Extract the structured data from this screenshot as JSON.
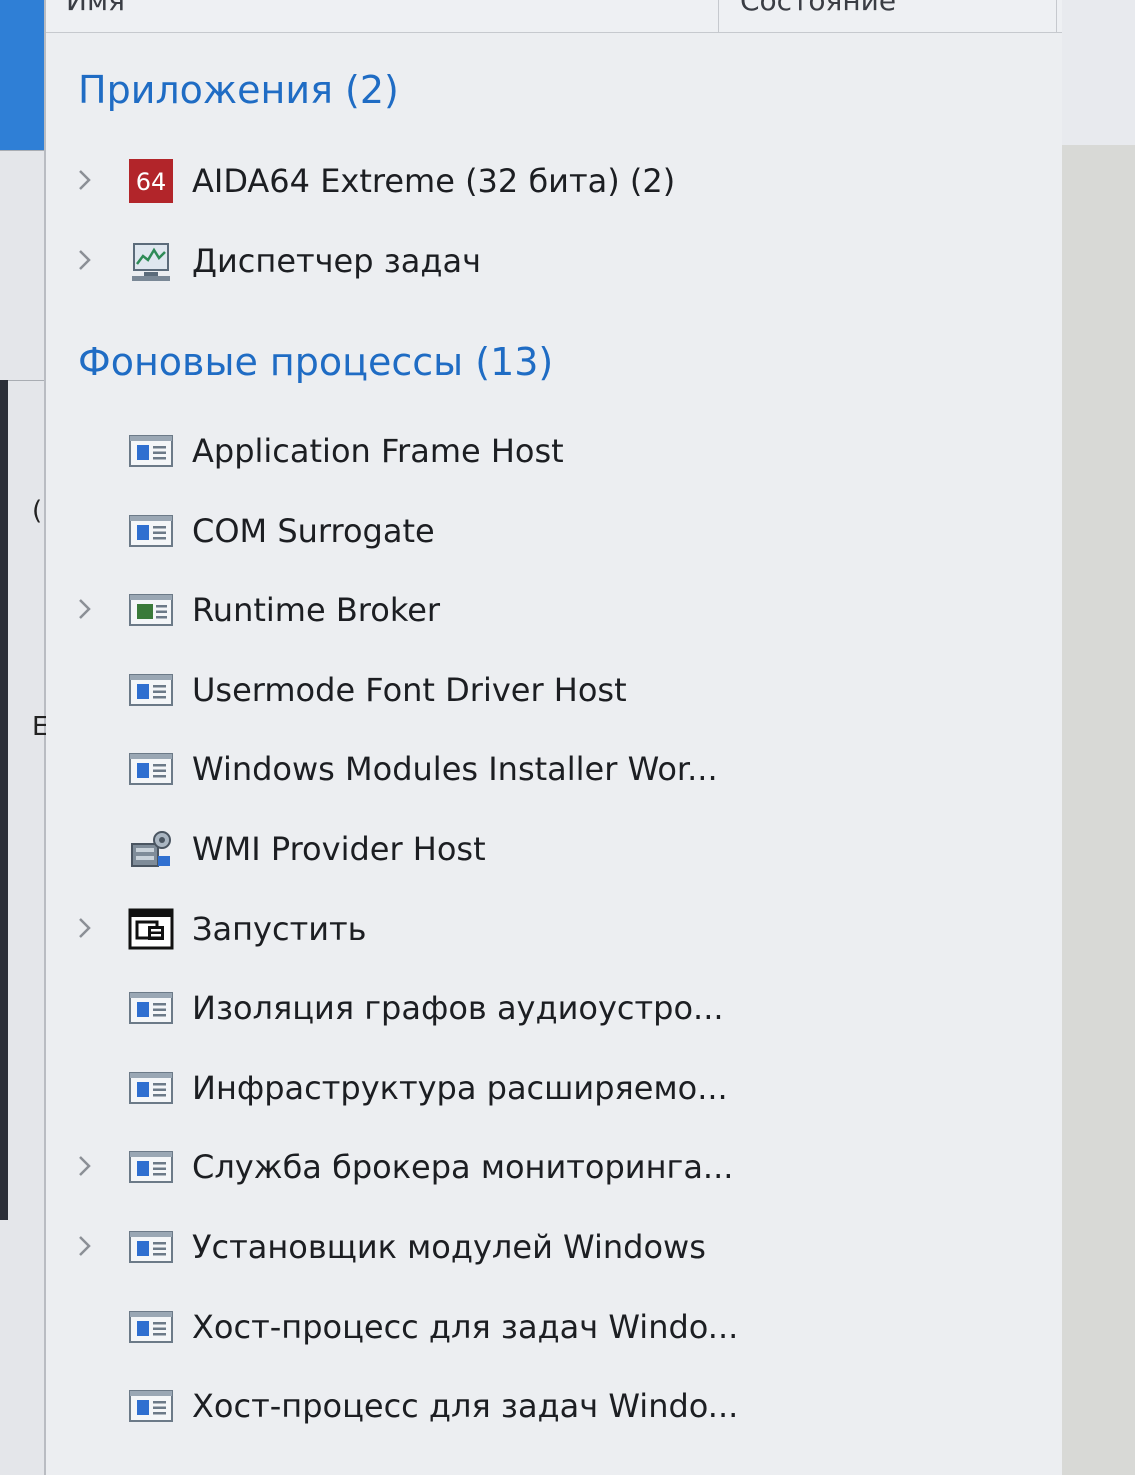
{
  "header": {
    "col_name": "Имя",
    "col_status": "Состояние"
  },
  "sidebar_fragments": {
    "frag1": "(",
    "frag2": "E"
  },
  "groups": {
    "apps": {
      "title": "Приложения (2)",
      "items": [
        {
          "label": "AIDA64 Extreme (32 бита) (2)",
          "icon": "aida64-icon",
          "expandable": true
        },
        {
          "label": "Диспетчер задач",
          "icon": "task-manager-icon",
          "expandable": true
        }
      ]
    },
    "background": {
      "title": "Фоновые процессы (13)",
      "items": [
        {
          "label": "Application Frame Host",
          "icon": "window-process-icon",
          "expandable": false
        },
        {
          "label": "COM Surrogate",
          "icon": "window-process-icon",
          "expandable": false
        },
        {
          "label": "Runtime Broker",
          "icon": "runtime-broker-icon",
          "expandable": true
        },
        {
          "label": "Usermode Font Driver Host",
          "icon": "window-process-icon",
          "expandable": false
        },
        {
          "label": "Windows Modules Installer Wor...",
          "icon": "window-process-icon",
          "expandable": false
        },
        {
          "label": "WMI Provider Host",
          "icon": "wmi-provider-icon",
          "expandable": false
        },
        {
          "label": "Запустить",
          "icon": "run-dialog-icon",
          "expandable": true
        },
        {
          "label": "Изоляция графов аудиоустро...",
          "icon": "window-process-icon",
          "expandable": false
        },
        {
          "label": "Инфраструктура расширяемо...",
          "icon": "window-process-icon",
          "expandable": false
        },
        {
          "label": "Служба брокера мониторинга...",
          "icon": "window-process-icon",
          "expandable": true
        },
        {
          "label": "Установщик модулей Windows",
          "icon": "window-process-icon",
          "expandable": true
        },
        {
          "label": "Хост-процесс для задач Windo...",
          "icon": "window-process-icon",
          "expandable": false
        },
        {
          "label": "Хост-процесс для задач Windo...",
          "icon": "window-process-icon",
          "expandable": false
        }
      ]
    }
  },
  "colors": {
    "group_title": "#1f6cc4",
    "aida_icon_bg": "#b2252a",
    "accent_blue": "#2f7fd6"
  }
}
